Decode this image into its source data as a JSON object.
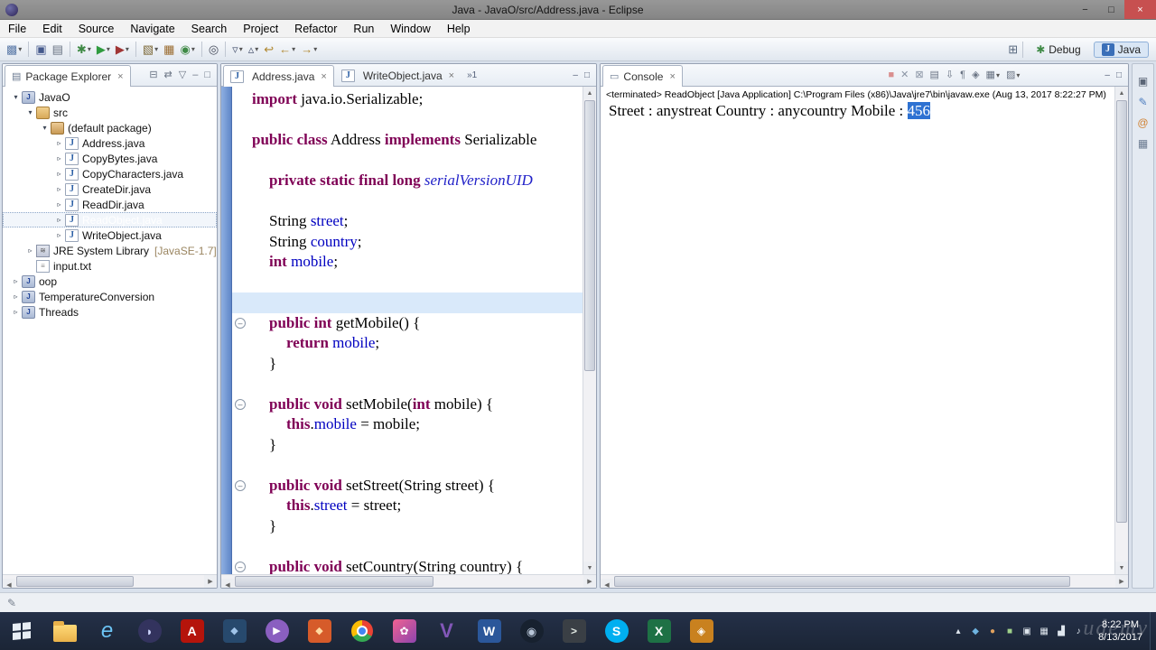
{
  "titlebar": {
    "title": "Java - JavaO/src/Address.java - Eclipse",
    "minimize": "−",
    "maximize": "□",
    "close": "×"
  },
  "menubar": {
    "items": [
      "File",
      "Edit",
      "Source",
      "Navigate",
      "Search",
      "Project",
      "Refactor",
      "Run",
      "Window",
      "Help"
    ]
  },
  "toolbar": {
    "items": [
      {
        "name": "new-wizard-icon",
        "glyph": "▩",
        "color": "#5b7aa8",
        "dd": true
      },
      {
        "sep": true
      },
      {
        "name": "save-icon",
        "glyph": "▣",
        "color": "#44598c"
      },
      {
        "name": "print-icon",
        "glyph": "▤",
        "color": "#667080"
      },
      {
        "sep": true
      },
      {
        "name": "debug-icon",
        "glyph": "✱",
        "color": "#3f8a46",
        "dd": true
      },
      {
        "name": "run-icon",
        "glyph": "▶",
        "color": "#2f9b3f",
        "dd": true
      },
      {
        "name": "external-tools-icon",
        "glyph": "▶",
        "color": "#a03535",
        "dd": true
      },
      {
        "sep": true
      },
      {
        "name": "new-java-project-icon",
        "glyph": "▧",
        "color": "#7d6a3a",
        "dd": true
      },
      {
        "name": "new-package-icon",
        "glyph": "▦",
        "color": "#9a6b2f"
      },
      {
        "name": "new-class-icon",
        "glyph": "◉",
        "color": "#3f8a46",
        "dd": true
      },
      {
        "sep": true
      },
      {
        "name": "search-icon",
        "glyph": "◎",
        "color": "#444a5a"
      },
      {
        "sep": true
      },
      {
        "name": "next-annotation-icon",
        "glyph": "▿",
        "color": "#55607a",
        "dd": true
      },
      {
        "name": "previous-annotation-icon",
        "glyph": "▵",
        "color": "#55607a",
        "dd": true
      },
      {
        "name": "last-edit-location-icon",
        "glyph": "↩",
        "color": "#b08830"
      },
      {
        "name": "back-icon",
        "glyph": "←",
        "color": "#b08830",
        "dd": true
      },
      {
        "name": "forward-icon",
        "glyph": "→",
        "color": "#b08830",
        "dd": true
      }
    ],
    "perspectives": {
      "grid": "⊞",
      "debug_glyph": "✱",
      "debug_label": "Debug",
      "java_glyph": "J",
      "java_label": "Java"
    }
  },
  "explorer": {
    "title": "Package Explorer",
    "tab_glyph": "▤",
    "close_glyph": "×",
    "header_icons": [
      {
        "name": "collapse-all-icon",
        "glyph": "⊟"
      },
      {
        "name": "link-with-editor-icon",
        "glyph": "⇄"
      },
      {
        "name": "view-menu-icon",
        "glyph": "▽"
      },
      {
        "name": "minimize-view-icon",
        "glyph": "–"
      },
      {
        "name": "maximize-view-icon",
        "glyph": "□"
      }
    ],
    "tree": [
      {
        "indent": 0,
        "arrow": "open",
        "icon": "project",
        "label": "JavaO"
      },
      {
        "indent": 1,
        "arrow": "open",
        "icon": "src",
        "label": "src"
      },
      {
        "indent": 2,
        "arrow": "open",
        "icon": "package",
        "label": "(default package)"
      },
      {
        "indent": 3,
        "arrow": "closed",
        "icon": "jfile",
        "label": "Address.java"
      },
      {
        "indent": 3,
        "arrow": "closed",
        "icon": "jfile",
        "label": "CopyBytes.java"
      },
      {
        "indent": 3,
        "arrow": "closed",
        "icon": "jfile",
        "label": "CopyCharacters.java"
      },
      {
        "indent": 3,
        "arrow": "closed",
        "icon": "jfile",
        "label": "CreateDir.java"
      },
      {
        "indent": 3,
        "arrow": "closed",
        "icon": "jfile",
        "label": "ReadDir.java"
      },
      {
        "indent": 3,
        "arrow": "closed",
        "icon": "jfile",
        "label": "ReadObject.java",
        "selected": true
      },
      {
        "indent": 3,
        "arrow": "closed",
        "icon": "jfile",
        "label": "WriteObject.java"
      },
      {
        "indent": 1,
        "arrow": "closed",
        "icon": "lib",
        "label": "JRE System Library",
        "decorator": "[JavaSE-1.7]"
      },
      {
        "indent": 1,
        "arrow": "none",
        "icon": "file",
        "label": "input.txt"
      },
      {
        "indent": 0,
        "arrow": "closed",
        "icon": "project",
        "label": "oop"
      },
      {
        "indent": 0,
        "arrow": "closed",
        "icon": "project",
        "label": "TemperatureConversion"
      },
      {
        "indent": 0,
        "arrow": "closed",
        "icon": "project",
        "label": "Threads"
      }
    ]
  },
  "editor": {
    "tabs": [
      {
        "label": "Address.java",
        "active": true
      },
      {
        "label": "WriteObject.java",
        "active": false
      }
    ],
    "overflow": "»1",
    "minimize": "–",
    "maximize": "□",
    "lines": [
      {
        "indent": 0,
        "tokens": [
          {
            "s": "k",
            "t": "import"
          },
          {
            "s": "p",
            "t": " java.io.Serializable;"
          }
        ]
      },
      {
        "indent": 0,
        "tokens": []
      },
      {
        "indent": 0,
        "tokens": [
          {
            "s": "k",
            "t": "public class"
          },
          {
            "s": "p",
            "t": " Address "
          },
          {
            "s": "k",
            "t": "implements"
          },
          {
            "s": "p",
            "t": " Serializable"
          }
        ]
      },
      {
        "indent": 0,
        "tokens": []
      },
      {
        "indent": 1,
        "tokens": [
          {
            "s": "k",
            "t": "private static final long"
          },
          {
            "s": "p",
            "t": " "
          },
          {
            "s": "i",
            "t": "serialVersionUID"
          }
        ]
      },
      {
        "indent": 0,
        "tokens": []
      },
      {
        "indent": 1,
        "tokens": [
          {
            "s": "p",
            "t": "String "
          },
          {
            "s": "f",
            "t": "street"
          },
          {
            "s": "p",
            "t": ";"
          }
        ]
      },
      {
        "indent": 1,
        "tokens": [
          {
            "s": "p",
            "t": "String "
          },
          {
            "s": "f",
            "t": "country"
          },
          {
            "s": "p",
            "t": ";"
          }
        ]
      },
      {
        "indent": 1,
        "tokens": [
          {
            "s": "k",
            "t": "int"
          },
          {
            "s": "p",
            "t": " "
          },
          {
            "s": "f",
            "t": "mobile"
          },
          {
            "s": "p",
            "t": ";"
          }
        ]
      },
      {
        "indent": 0,
        "tokens": []
      },
      {
        "indent": 0,
        "tokens": [],
        "hl": true
      },
      {
        "indent": 1,
        "fold": true,
        "tokens": [
          {
            "s": "k",
            "t": "public int"
          },
          {
            "s": "p",
            "t": " getMobile() {"
          }
        ]
      },
      {
        "indent": 2,
        "tokens": [
          {
            "s": "k",
            "t": "return"
          },
          {
            "s": "p",
            "t": " "
          },
          {
            "s": "f",
            "t": "mobile"
          },
          {
            "s": "p",
            "t": ";"
          }
        ]
      },
      {
        "indent": 1,
        "tokens": [
          {
            "s": "p",
            "t": "}"
          }
        ]
      },
      {
        "indent": 0,
        "tokens": []
      },
      {
        "indent": 1,
        "fold": true,
        "tokens": [
          {
            "s": "k",
            "t": "public void"
          },
          {
            "s": "p",
            "t": " setMobile("
          },
          {
            "s": "k",
            "t": "int"
          },
          {
            "s": "p",
            "t": " mobile) {"
          }
        ]
      },
      {
        "indent": 2,
        "tokens": [
          {
            "s": "k",
            "t": "this"
          },
          {
            "s": "p",
            "t": "."
          },
          {
            "s": "f",
            "t": "mobile"
          },
          {
            "s": "p",
            "t": " = mobile;"
          }
        ]
      },
      {
        "indent": 1,
        "tokens": [
          {
            "s": "p",
            "t": "}"
          }
        ]
      },
      {
        "indent": 0,
        "tokens": []
      },
      {
        "indent": 1,
        "fold": true,
        "tokens": [
          {
            "s": "k",
            "t": "public void"
          },
          {
            "s": "p",
            "t": " setStreet(String street) {"
          }
        ]
      },
      {
        "indent": 2,
        "tokens": [
          {
            "s": "k",
            "t": "this"
          },
          {
            "s": "p",
            "t": "."
          },
          {
            "s": "f",
            "t": "street"
          },
          {
            "s": "p",
            "t": " = street;"
          }
        ]
      },
      {
        "indent": 1,
        "tokens": [
          {
            "s": "p",
            "t": "}"
          }
        ]
      },
      {
        "indent": 0,
        "tokens": []
      },
      {
        "indent": 1,
        "fold": true,
        "tokens": [
          {
            "s": "k",
            "t": "public void"
          },
          {
            "s": "p",
            "t": " setCountry(String country) {"
          }
        ]
      }
    ]
  },
  "console": {
    "title": "Console",
    "tab_glyph": "▭",
    "close_glyph": "×",
    "terminated": "<terminated> ReadObject [Java Application] C:\\Program Files (x86)\\Java\\jre7\\bin\\javaw.exe (Aug 13, 2017 8:22:27 PM)",
    "output_prefix": "Street : anystreat Country : anycountry Mobile : ",
    "output_selected": "456",
    "minimize": "–",
    "maximize": "□",
    "header_icons": [
      {
        "name": "terminate-icon",
        "glyph": "■",
        "color": "#d98f8f"
      },
      {
        "name": "remove-launch-icon",
        "glyph": "✕",
        "color": "#8a94a4"
      },
      {
        "name": "remove-all-launches-icon",
        "glyph": "⊠",
        "color": "#8a94a4"
      },
      {
        "name": "clear-console-icon",
        "glyph": "▤",
        "color": "#6a7484"
      },
      {
        "name": "scroll-lock-icon",
        "glyph": "⇩",
        "color": "#6a7484"
      },
      {
        "name": "word-wrap-icon",
        "glyph": "¶",
        "color": "#6a7484"
      },
      {
        "name": "pin-console-icon",
        "glyph": "◈",
        "color": "#6a7484"
      },
      {
        "name": "display-selected-console-icon",
        "glyph": "▦",
        "color": "#6a7484",
        "dd": true
      },
      {
        "name": "open-console-icon",
        "glyph": "▨",
        "color": "#6a7484",
        "dd": true
      }
    ]
  },
  "right_strip": {
    "icons": [
      {
        "name": "restore-views-icon",
        "glyph": "▣",
        "color": "#5a6576"
      },
      {
        "name": "task-list-view-icon",
        "glyph": "✎",
        "color": "#4d7dbf"
      },
      {
        "name": "outline-view-icon",
        "glyph": "@",
        "color": "#d08030"
      },
      {
        "name": "problems-view-icon",
        "glyph": "▦",
        "color": "#6a7a90"
      }
    ]
  },
  "statusbar": {
    "icon_glyph": "✎"
  },
  "taskbar": {
    "apps": [
      {
        "name": "file-explorer",
        "shape": "folder"
      },
      {
        "name": "internet-explorer",
        "shape": "letter",
        "letter": "e",
        "fg": "#6cc4f5",
        "fs": 24,
        "italic": true
      },
      {
        "name": "eclipse",
        "shape": "circle",
        "bg": "#33335e",
        "letter": "◗",
        "fg": "#cfd6ff",
        "fs": 13
      },
      {
        "name": "adobe-reader",
        "shape": "square",
        "bg": "#b5140b",
        "letter": "A",
        "fg": "#ffffff",
        "bold": true
      },
      {
        "name": "app-dark-blue",
        "shape": "square",
        "bg": "#27496d",
        "letter": "◆",
        "fg": "#9fc3e8",
        "fs": 11
      },
      {
        "name": "media-player",
        "shape": "circle",
        "bg": "#8a5fc0",
        "letter": "▶",
        "fg": "#ffffff",
        "fs": 11
      },
      {
        "name": "app-red-orange",
        "shape": "square",
        "bg": "#d65b2a",
        "letter": "◆",
        "fg": "#ffd9a0",
        "fs": 11
      },
      {
        "name": "chrome",
        "shape": "chrome"
      },
      {
        "name": "photo-app",
        "shape": "square",
        "bg": "linear-gradient(135deg,#f06292,#8e44ad)",
        "letter": "✿",
        "fg": "#ffffff",
        "fs": 12
      },
      {
        "name": "visio",
        "shape": "letter",
        "letter": "V",
        "fg": "#8257b8",
        "fs": 22,
        "bold": true
      },
      {
        "name": "word",
        "shape": "square",
        "bg": "#2b579a",
        "letter": "W",
        "fg": "#ffffff",
        "bold": true
      },
      {
        "name": "steam",
        "shape": "circle",
        "bg": "#17212f",
        "letter": "◉",
        "fg": "#b8c6d8",
        "fs": 13
      },
      {
        "name": "command-prompt",
        "shape": "square",
        "bg": "#3a3f45",
        "letter": ">",
        "fg": "#dfe6e0",
        "fs": 12,
        "bold": true
      },
      {
        "name": "skype",
        "shape": "circle",
        "bg": "#00aff0",
        "letter": "S",
        "fg": "#ffffff",
        "bold": true
      },
      {
        "name": "excel",
        "shape": "square",
        "bg": "#1e7145",
        "letter": "X",
        "fg": "#ffffff",
        "bold": true
      },
      {
        "name": "app-orange",
        "shape": "square",
        "bg": "#c9811f",
        "letter": "◈",
        "fg": "#ffffff",
        "fs": 12
      }
    ],
    "tray": [
      {
        "name": "show-hidden-icons-icon",
        "glyph": "▴"
      },
      {
        "name": "bluetooth-icon",
        "glyph": "◆",
        "color": "#6fb3e0"
      },
      {
        "name": "antivirus-icon",
        "glyph": "●",
        "color": "#e0a15e"
      },
      {
        "name": "cloud-sync-icon",
        "glyph": "■",
        "color": "#9fd08a"
      },
      {
        "name": "display-icon",
        "glyph": "▣"
      },
      {
        "name": "touch-keyboard-icon",
        "glyph": "▦"
      },
      {
        "name": "network-icon",
        "glyph": "▟"
      },
      {
        "name": "volume-icon",
        "glyph": "♪"
      }
    ],
    "clock": {
      "time": "8:22 PM",
      "date": "8/13/2017"
    },
    "watermark": "udemy"
  }
}
